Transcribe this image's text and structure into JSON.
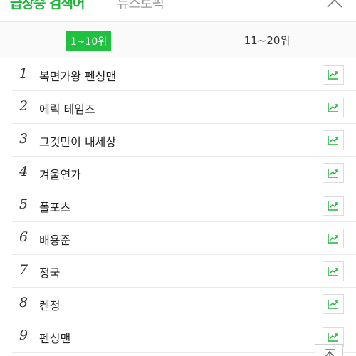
{
  "header": {
    "tab_active": "급상승 검색어",
    "tab_inactive": "뉴스토픽",
    "collapse_icon": "chevron-up-icon"
  },
  "range": {
    "left_label": "1~10위",
    "right_label": "11~20위"
  },
  "colors": {
    "accent": "#20c040",
    "trend_icon": "#1fb53a"
  },
  "rows": [
    {
      "rank": "1",
      "keyword": "복면가왕 펜싱맨"
    },
    {
      "rank": "2",
      "keyword": "에릭 테임즈"
    },
    {
      "rank": "3",
      "keyword": "그것만이 내세상"
    },
    {
      "rank": "4",
      "keyword": "겨울연가"
    },
    {
      "rank": "5",
      "keyword": "폴포츠"
    },
    {
      "rank": "6",
      "keyword": "배용준"
    },
    {
      "rank": "7",
      "keyword": "정국"
    },
    {
      "rank": "8",
      "keyword": "켄정"
    },
    {
      "rank": "9",
      "keyword": "펜싱맨"
    }
  ],
  "top_button_icon": "scroll-to-top-icon"
}
